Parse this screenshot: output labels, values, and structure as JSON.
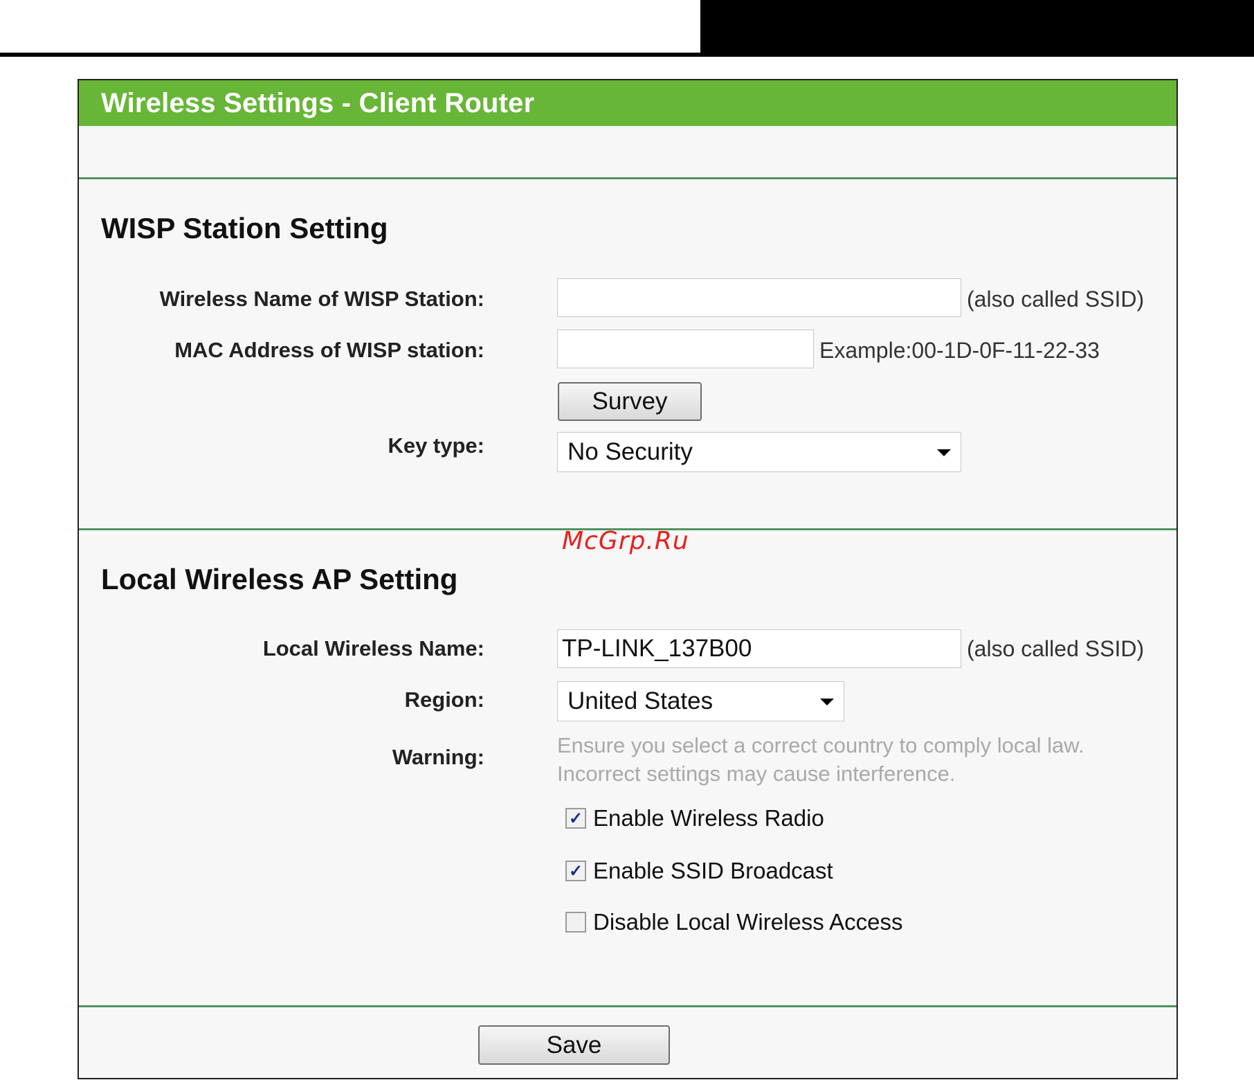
{
  "page": {
    "title": "Wireless Settings - Client Router"
  },
  "wisp": {
    "heading": "WISP Station Setting",
    "wireless_name_label": "Wireless Name of WISP Station:",
    "wireless_name_value": "",
    "wireless_name_hint": "(also called SSID)",
    "mac_label": "MAC Address of WISP station:",
    "mac_value": "",
    "mac_hint": "Example:00-1D-0F-11-22-33",
    "survey_label": "Survey",
    "key_type_label": "Key type:",
    "key_type_value": "No Security"
  },
  "watermark": "McGrp.Ru",
  "local": {
    "heading": "Local Wireless AP Setting",
    "name_label": "Local Wireless Name:",
    "name_value": "TP-LINK_137B00",
    "name_hint": "(also called SSID)",
    "region_label": "Region:",
    "region_value": "United States",
    "warning_label": "Warning:",
    "warning_line1": "Ensure you select a correct country to comply local law.",
    "warning_line2": "Incorrect settings may cause interference.",
    "checkboxes": [
      {
        "label": "Enable Wireless Radio",
        "checked": true
      },
      {
        "label": "Enable SSID Broadcast",
        "checked": true
      },
      {
        "label": "Disable Local Wireless Access",
        "checked": false
      }
    ]
  },
  "footer": {
    "save_label": "Save"
  }
}
